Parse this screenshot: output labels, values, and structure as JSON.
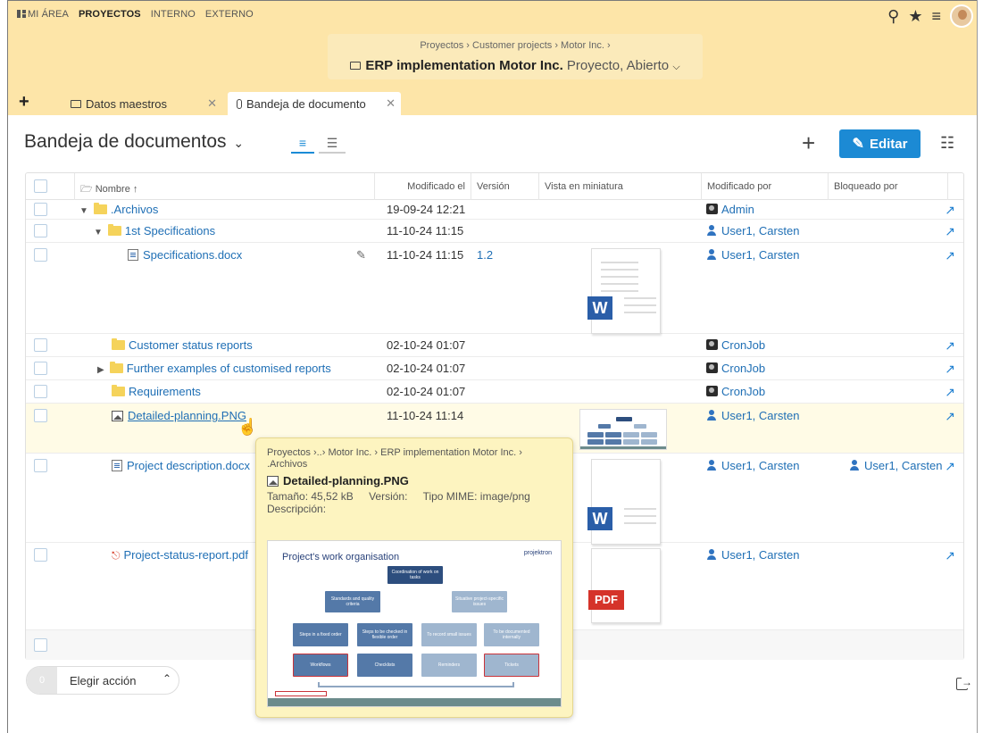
{
  "topnav": {
    "items": [
      "MI ÁREA",
      "PROYECTOS",
      "INTERNO",
      "EXTERNO"
    ]
  },
  "project": {
    "breadcrumb": "Proyectos › Customer projects › Motor Inc. ›",
    "title": "ERP implementation Motor Inc.",
    "subtitle": "Proyecto, Abierto"
  },
  "tabs": [
    {
      "label": "Datos maestros"
    },
    {
      "label": "Bandeja de documento"
    }
  ],
  "page": {
    "title": "Bandeja de documentos",
    "edit_label": "Editar"
  },
  "table": {
    "headers": {
      "name": "Nombre ↑",
      "modified": "Modificado el",
      "version": "Versión",
      "thumbnail": "Vista en miniatura",
      "modified_by": "Modificado por",
      "locked_by": "Bloqueado por"
    },
    "rows": [
      {
        "name": ".Archivos",
        "date": "19-09-24 12:21",
        "version": "",
        "modified_by": "Admin",
        "locked_by": ""
      },
      {
        "name": "1st Specifications",
        "date": "11-10-24 11:15",
        "version": "",
        "modified_by": "User1, Carsten",
        "locked_by": ""
      },
      {
        "name": "Specifications.docx",
        "date": "11-10-24 11:15",
        "version": "1.2",
        "modified_by": "User1, Carsten",
        "locked_by": ""
      },
      {
        "name": "Customer status reports",
        "date": "02-10-24 01:07",
        "version": "",
        "modified_by": "CronJob",
        "locked_by": ""
      },
      {
        "name": "Further examples of customised reports",
        "date": "02-10-24 01:07",
        "version": "",
        "modified_by": "CronJob",
        "locked_by": ""
      },
      {
        "name": "Requirements",
        "date": "02-10-24 01:07",
        "version": "",
        "modified_by": "CronJob",
        "locked_by": ""
      },
      {
        "name": "Detailed-planning.PNG",
        "date": "11-10-24 11:14",
        "version": "",
        "modified_by": "User1, Carsten",
        "locked_by": ""
      },
      {
        "name": "Project description.docx",
        "date": "",
        "version": "",
        "modified_by": "User1, Carsten",
        "locked_by": "User1, Carsten"
      },
      {
        "name": "Project-status-report.pdf",
        "date": "",
        "version": "",
        "modified_by": "User1, Carsten",
        "locked_by": ""
      }
    ]
  },
  "thumbs": {
    "word": "W",
    "pdf": "PDF"
  },
  "footer": {
    "count": "0",
    "action_label": "Elegir acción"
  },
  "tooltip": {
    "breadcrumb": "Proyectos ›..› Motor Inc. › ERP implementation Motor Inc. › .Archivos",
    "name": "Detailed-planning.PNG",
    "size": "Tamaño: 45,52 kB",
    "version": "Versión:",
    "mime": "Tipo MIME: image/png",
    "description": "Descripción:",
    "preview": {
      "title": "Project's work organisation",
      "brand": "projektron",
      "top_box": "Coordination of work on tasks",
      "mid_left": "Standards and quality criteria",
      "mid_right": "Situative project-specific issues",
      "row3": [
        "Steps in a fixed order",
        "Steps to be checked in flexible order",
        "To record small issues",
        "To be documented internally"
      ],
      "row4": [
        "Workflows",
        "Checklists",
        "Reminders",
        "Tickets"
      ]
    }
  }
}
